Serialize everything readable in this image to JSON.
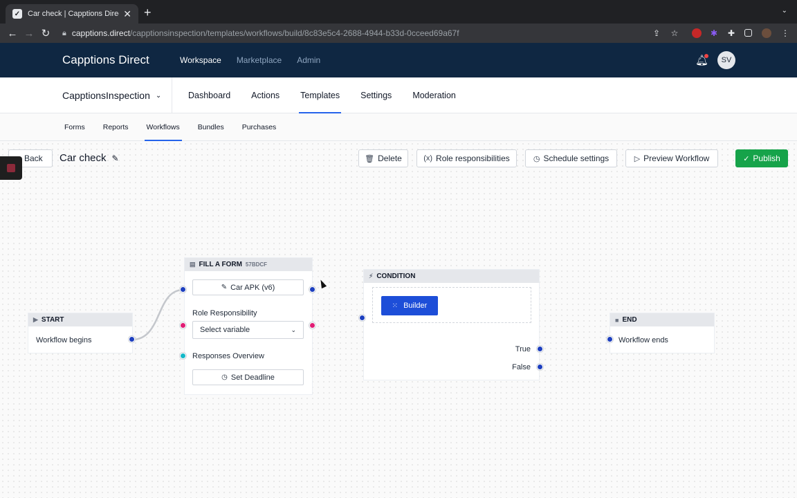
{
  "browser": {
    "tab_title": "Car check | Capptions Direct",
    "tab_close": "✕",
    "new_tab": "+",
    "url_host": "capptions.direct",
    "url_path": "/capptionsinspection/templates/workflows/build/8c83e5c4-2688-4944-b33d-0cceed69a67f"
  },
  "app": {
    "brand": "Capptions Direct",
    "topnav": [
      "Workspace",
      "Marketplace",
      "Admin"
    ],
    "active_topnav": "Workspace",
    "avatar_initials": "SV"
  },
  "subnav": {
    "org": "CapptionsInspection",
    "items": [
      "Dashboard",
      "Actions",
      "Templates",
      "Settings",
      "Moderation"
    ],
    "active": "Templates"
  },
  "templates_nav": {
    "items": [
      "Forms",
      "Reports",
      "Workflows",
      "Bundles",
      "Purchases"
    ],
    "active": "Workflows"
  },
  "toolbar": {
    "back_label": "Back",
    "title": "Car check",
    "delete_label": "Delete",
    "roles_label": "Role responsibilities",
    "schedule_label": "Schedule settings",
    "preview_label": "Preview Workflow",
    "publish_label": "Publish",
    "roles_icon_text": "(x)"
  },
  "nodes": {
    "start": {
      "title": "START",
      "text": "Workflow begins"
    },
    "form": {
      "title": "FILL A FORM",
      "code": "57BDCF",
      "form_button": "Car APK (v6)",
      "role_label": "Role Responsibility",
      "role_select": "Select variable",
      "responses_label": "Responses Overview",
      "deadline_button": "Set Deadline"
    },
    "condition": {
      "title": "CONDITION",
      "builder_label": "Builder",
      "true_label": "True",
      "false_label": "False"
    },
    "end": {
      "title": "END",
      "text": "Workflow ends"
    }
  },
  "colors": {
    "header_bg": "#0f2742",
    "accent": "#2563eb",
    "publish": "#16a34a",
    "port_blue": "#1d3fbf",
    "port_pink": "#e11d74",
    "port_teal": "#14b8c8"
  }
}
